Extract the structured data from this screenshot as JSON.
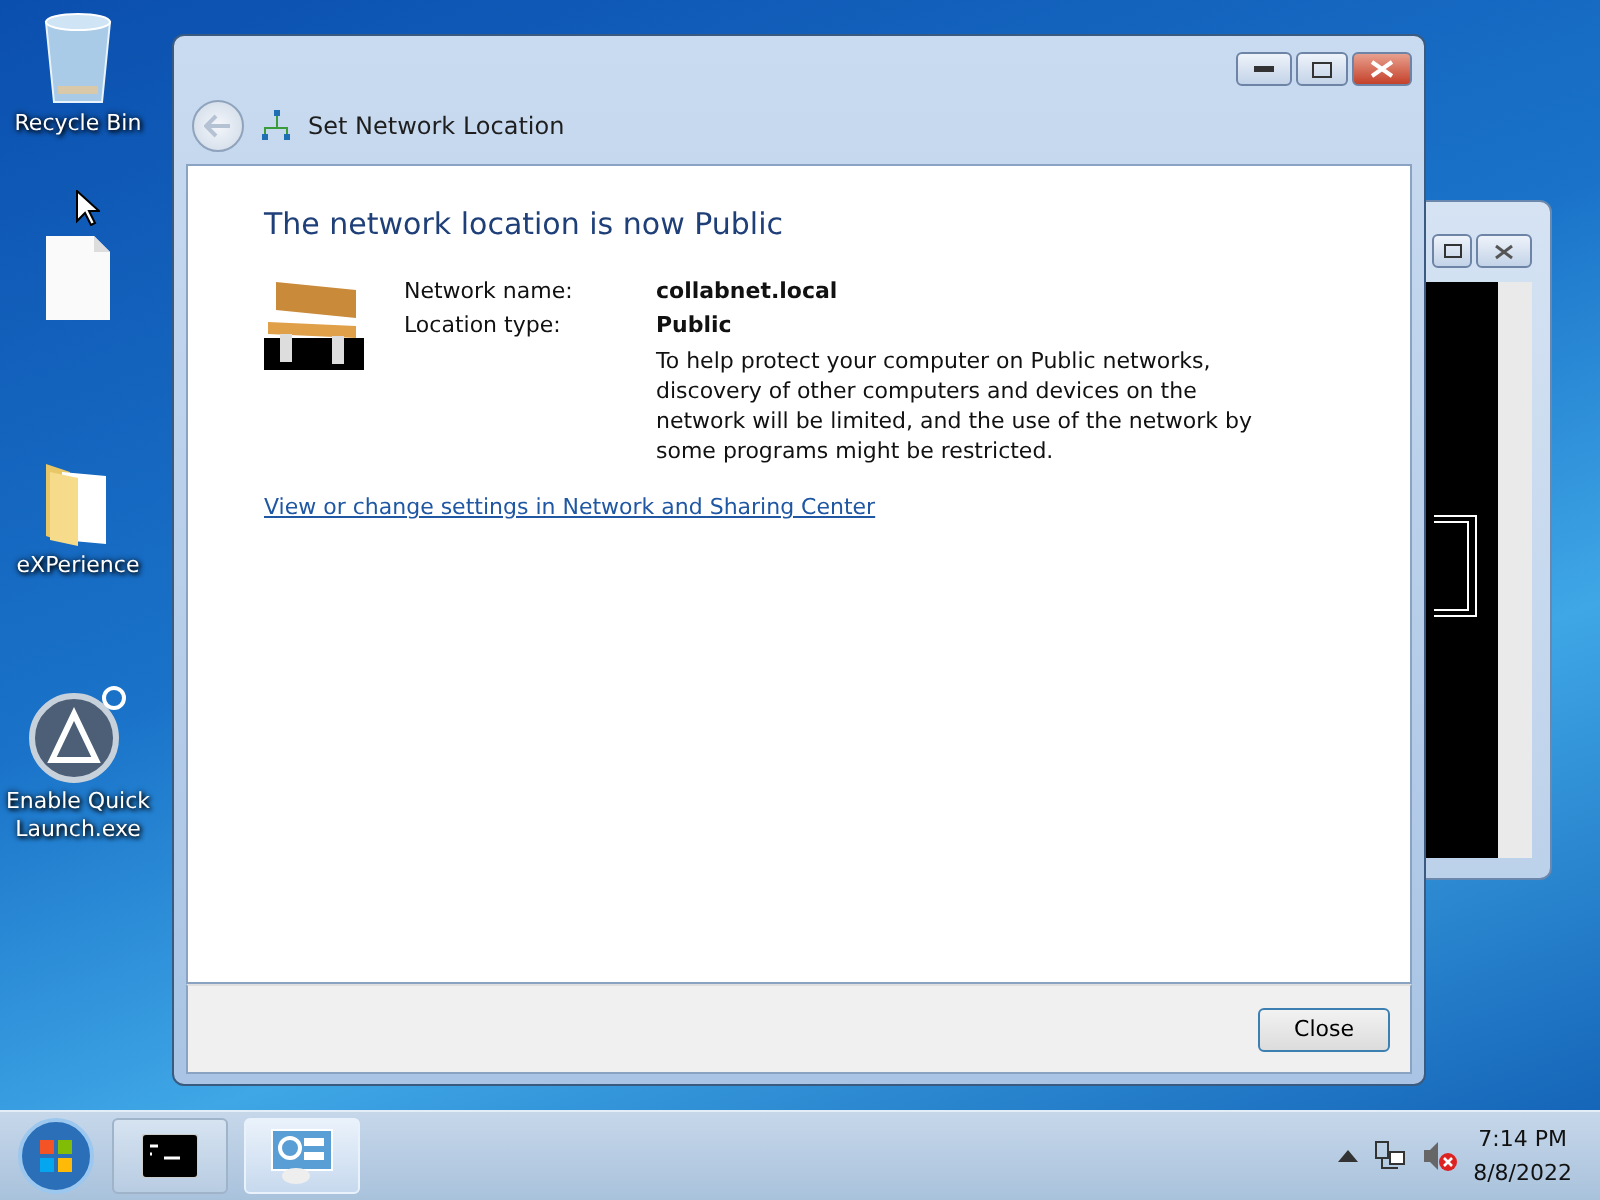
{
  "desktop_icons": [
    {
      "kind": "recycle",
      "label": "Recycle Bin"
    },
    {
      "kind": "file"
    },
    {
      "kind": "folder",
      "label": "eXPerience"
    },
    {
      "kind": "app",
      "label": "Enable Quick Launch.exe"
    }
  ],
  "dialog": {
    "title": "Set Network Location",
    "heading": "The network location is now Public",
    "fields": [
      {
        "label": "Network name:",
        "value": "collabnet.local"
      },
      {
        "label": "Location type:",
        "value": "Public"
      }
    ],
    "description": "To help protect your computer on Public networks, discovery of other computers and devices on the network will be limited, and the use of the network by some programs might be restricted.",
    "link": "View or change settings in Network and Sharing Center",
    "buttons": [
      "Close"
    ]
  },
  "taskbar": {
    "buttons": [
      {
        "kind": "console",
        "selected": false
      },
      {
        "kind": "network",
        "selected": true
      }
    ],
    "volume": {
      "muted": true
    },
    "time": "7:14 PM",
    "date": "8/8/2022"
  }
}
